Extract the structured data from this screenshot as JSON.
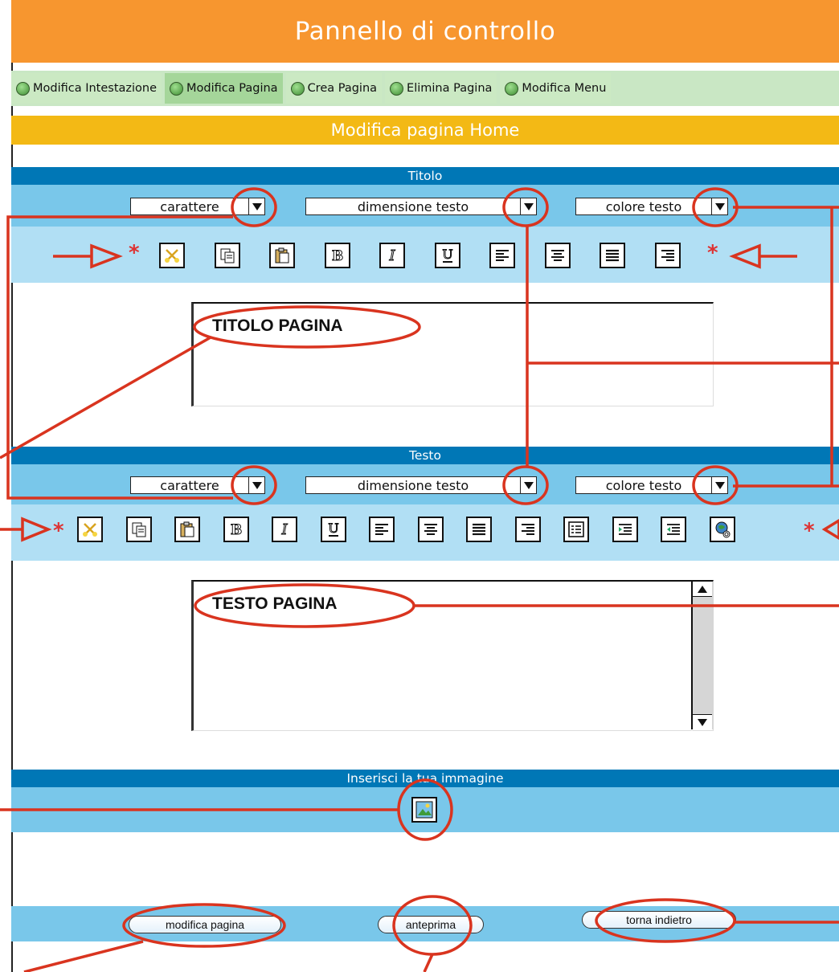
{
  "header": {
    "title": "Pannello di controllo"
  },
  "nav": {
    "items": [
      {
        "label": "Modifica Intestazione"
      },
      {
        "label": "Modifica Pagina"
      },
      {
        "label": "Crea Pagina"
      },
      {
        "label": "Elimina Pagina"
      },
      {
        "label": "Modifica Menu"
      }
    ]
  },
  "page_heading": "Modifica pagina Home",
  "title_section": {
    "label": "Titolo",
    "font_select": "carattere",
    "size_select": "dimensione testo",
    "color_select": "colore testo",
    "content": "TITOLO PAGINA"
  },
  "text_section": {
    "label": "Testo",
    "font_select": "carattere",
    "size_select": "dimensione testo",
    "color_select": "colore testo",
    "content": "TESTO PAGINA"
  },
  "image_section": {
    "label": "Inserisci la tua immagine"
  },
  "actions": {
    "modify": "modifica pagina",
    "preview": "anteprima",
    "back": "torna indietro"
  },
  "annotation_marker": "*",
  "colors": {
    "header": "#f7962f",
    "nav": "#c9e7c4",
    "subheader": "#f3b915",
    "band_dark": "#0077b6",
    "band_mid": "#79c7ea",
    "band_light": "#b1dff4",
    "annotation": "#d9341f"
  }
}
